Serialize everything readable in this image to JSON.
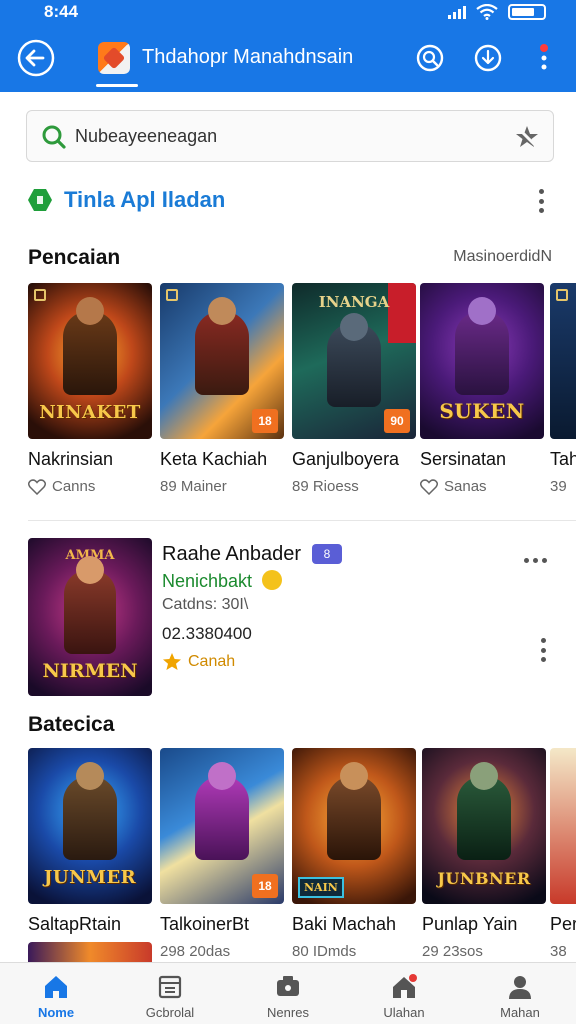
{
  "status": {
    "time": "8:44"
  },
  "appbar": {
    "title": "Thdahopr Manahdnsain"
  },
  "search": {
    "text": "Nubeayeeneagan"
  },
  "section": {
    "title": "Tinla Apl Iladan"
  },
  "row1": {
    "heading": "Pencaian",
    "more": "MasinoerdidN",
    "items": [
      {
        "title": "Nakrinsian",
        "sub": "Canns",
        "sub_icon": "heart-icon",
        "art": "NINAKET",
        "age": ""
      },
      {
        "title": "Keta Kachiah",
        "sub": "89 Mainer",
        "sub_icon": "",
        "art": "",
        "age": "18"
      },
      {
        "title": "Ganjulboyera",
        "sub": "89 Rioess",
        "sub_icon": "",
        "art": "INANGA",
        "age": "90"
      },
      {
        "title": "Sersinatan",
        "sub": "Sanas",
        "sub_icon": "heart-icon",
        "art": "SUKEN",
        "age": ""
      },
      {
        "title": "Tah",
        "sub": "39",
        "sub_icon": "",
        "art": "",
        "age": ""
      }
    ]
  },
  "featured": {
    "title": "Raahe Anbader",
    "badge": "8",
    "developer": "Nenichbakt",
    "size": "Catdns: 30I\\",
    "number": "02.3380400",
    "rating": "Canah",
    "art": "NIRMEN"
  },
  "row2": {
    "heading": "Batecica",
    "items": [
      {
        "title": "SaltapRtain",
        "sub": "",
        "art": "JUNMER",
        "age": ""
      },
      {
        "title": "TalkoinerBt",
        "sub": "298 20das",
        "art": "",
        "age": "18"
      },
      {
        "title": "Baki Machah",
        "sub": "80 IDmds",
        "art": "NAIN",
        "age": ""
      },
      {
        "title": "Punlap Yain",
        "sub": "29 23sos",
        "art": "JUNBNER",
        "age": ""
      },
      {
        "title": "Per",
        "sub": "38",
        "art": "",
        "age": ""
      }
    ]
  },
  "nav": [
    {
      "label": "Nome",
      "icon": "home-icon"
    },
    {
      "label": "Gcbrolal",
      "icon": "store-icon"
    },
    {
      "label": "Nenres",
      "icon": "gamepad-icon"
    },
    {
      "label": "Ulahan",
      "icon": "house-notify-icon"
    },
    {
      "label": "Mahan",
      "icon": "profile-icon"
    }
  ],
  "colors": {
    "accent": "#1877e6",
    "rating": "#f0a400",
    "developer": "#1b8a2e",
    "age_badge": "#f07020"
  }
}
